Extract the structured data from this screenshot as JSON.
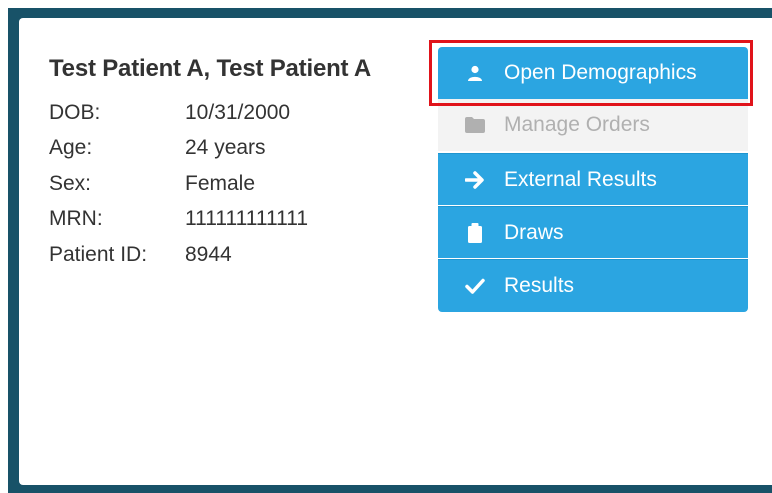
{
  "patient": {
    "name": "Test Patient A, Test Patient A",
    "fields": [
      {
        "label": "DOB:",
        "value": "10/31/2000"
      },
      {
        "label": "Age:",
        "value": "24 years"
      },
      {
        "label": "Sex:",
        "value": "Female"
      },
      {
        "label": "MRN:",
        "value": "111111111111"
      },
      {
        "label": "Patient ID:",
        "value": "8944"
      }
    ]
  },
  "menu": {
    "items": [
      {
        "label": "Open Demographics",
        "icon": "user-icon",
        "state": "active"
      },
      {
        "label": "Manage Orders",
        "icon": "folder-icon",
        "state": "disabled"
      },
      {
        "label": "External Results",
        "icon": "arrow-right-icon",
        "state": "enabled"
      },
      {
        "label": "Draws",
        "icon": "clipboard-icon",
        "state": "enabled"
      },
      {
        "label": "Results",
        "icon": "checkmark-icon",
        "state": "enabled"
      }
    ]
  },
  "colors": {
    "frame": "#185268",
    "menu_bg": "#2ba5e1",
    "disabled_bg": "#f3f3f3",
    "highlight": "#e0131a"
  }
}
